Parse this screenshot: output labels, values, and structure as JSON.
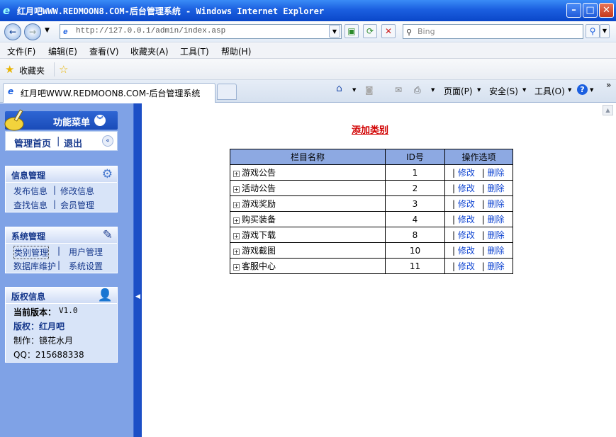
{
  "window": {
    "title": "红月吧WWW.REDMOON8.COM-后台管理系统 - Windows Internet Explorer"
  },
  "address_bar": {
    "url": "http://127.0.0.1/admin/index.asp",
    "search_placeholder": "Bing"
  },
  "menu": [
    "文件(F)",
    "编辑(E)",
    "查看(V)",
    "收藏夹(A)",
    "工具(T)",
    "帮助(H)"
  ],
  "favorites_bar": {
    "label": "收藏夹"
  },
  "tab": {
    "title": "红月吧WWW.REDMOON8.COM-后台管理系统"
  },
  "command_bar": {
    "page": "页面(P)",
    "safety": "安全(S)",
    "tools": "工具(O)"
  },
  "sidebar": {
    "header": "功能菜单",
    "home_link": "管理首页",
    "separator": "|",
    "logout_link": "退出",
    "panels": [
      {
        "title": "信息管理",
        "rows": [
          [
            "发布信息",
            "修改信息"
          ],
          [
            "查找信息",
            "会员管理"
          ]
        ]
      },
      {
        "title": "系统管理",
        "rows": [
          [
            "类别管理",
            "用户管理"
          ],
          [
            "数据库维护",
            "系统设置"
          ]
        ]
      }
    ],
    "copyright": {
      "title": "版权信息",
      "version_label": "当前版本：",
      "version_value": "V1.0",
      "owner": "版权：红月吧",
      "author": "制作：镜花水月",
      "qq": "QQ：215688338"
    }
  },
  "main": {
    "title": "添加类别",
    "table": {
      "headers": [
        "栏目名称",
        "ID号",
        "操作选项"
      ],
      "rows": [
        {
          "name": "游戏公告",
          "id": "1"
        },
        {
          "name": "活动公告",
          "id": "2"
        },
        {
          "name": "游戏奖励",
          "id": "3"
        },
        {
          "name": "购买装备",
          "id": "4"
        },
        {
          "name": "游戏下载",
          "id": "8"
        },
        {
          "name": "游戏截图",
          "id": "10"
        },
        {
          "name": "客服中心",
          "id": "11"
        }
      ],
      "op_edit": "修改",
      "op_delete": "删除",
      "op_sep": "|"
    }
  },
  "colors": {
    "accent": "#1c4fc6",
    "sidebar_bg": "#7fa2e6",
    "header_cell": "#8da9e2",
    "title_red": "#d10000"
  }
}
